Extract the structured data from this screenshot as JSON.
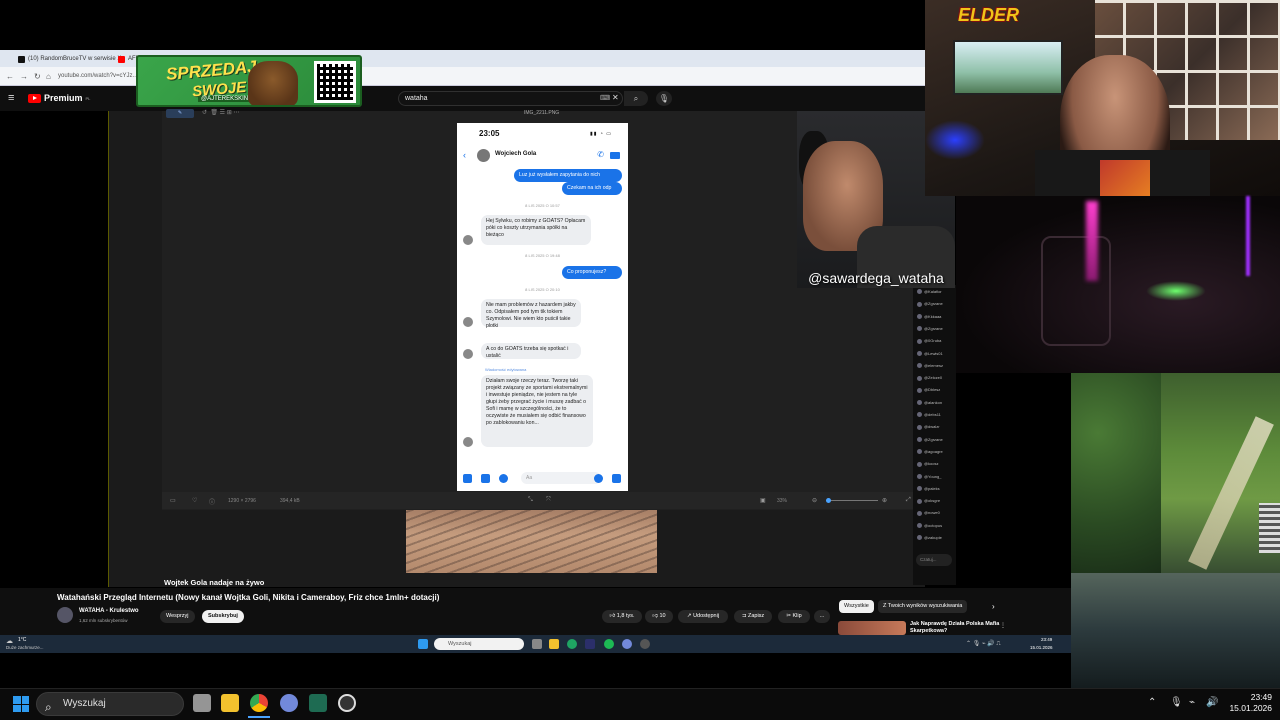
{
  "browser": {
    "tabs": [
      {
        "label": "(10) RandomBruceTV w serwisie X",
        "color": "#111"
      },
      {
        "label": "AFERA ...",
        "color": "#ff0000"
      }
    ],
    "url": "youtube.com/watch?v=cYJz..."
  },
  "promo": {
    "line1": "SPRZEDAJ",
    "line2": "SWOJE SKINY",
    "handle": "@AJTEREKSKINS"
  },
  "youtube": {
    "logo": "Premium",
    "logo_suffix": "PL",
    "search_value": "wataha",
    "stream_label": "Wojtek Gola nadaje na żywo",
    "video_title": "Watahański Przegląd Internetu (Nowy kanał Wojtka Goli, Nikita i Cameraboy, Friz chce 1mln+ dotacji)",
    "channel": {
      "name": "WATAHA - Krulestwo",
      "subs": "1,62 mln subskrybentów"
    },
    "support_btn": "Wesprzyj",
    "subscribe_btn": "Subskrybuj",
    "actions": {
      "likes": "1,8 tys.",
      "dislikes": "10",
      "share": "Udostępnij",
      "save": "Zapisz",
      "clip": "Klip",
      "more": "…"
    },
    "chips": [
      "Wszystkie",
      "Z Twoich wyników wyszukiwania"
    ],
    "next_video_title": "Jak Naprawdę Działa Polska Mafia Skarpetkowa?",
    "chat_placeholder": "Czatuj..."
  },
  "viewer": {
    "filename": "IMG_2211.PNG",
    "dimensions": "1290 × 2796",
    "filesize": "394,4 kB",
    "zoom": "33%"
  },
  "phone": {
    "time": "23:05",
    "contact": "Wojciech Gola",
    "composer_placeholder": "Aa",
    "messages": [
      {
        "dir": "out",
        "text": "Luz już wysłałem zapytania do nich"
      },
      {
        "dir": "out",
        "text": "Czekam na ich odp"
      },
      {
        "dir": "ts",
        "text": "8 LIS 2025 O 10:57"
      },
      {
        "dir": "in",
        "text": "Hej Sylwku, co robimy z GOATS? Opłacam póki co koszty utrzymania spółki na bieżąco"
      },
      {
        "dir": "ts",
        "text": "8 LIS 2025 O 19:48"
      },
      {
        "dir": "out",
        "text": "Co proponujesz?"
      },
      {
        "dir": "ts",
        "text": "8 LIS 2025 O 20:10"
      },
      {
        "dir": "in",
        "text": "Nie mam problemów z hazardem jakby co. Odpisałem pod tym tik tokiem Szymolowi. Nie wiem kto puścił takie plotki"
      },
      {
        "dir": "in",
        "text": "A co do GOATS trzeba się spotkać i ustalić"
      },
      {
        "dir": "edited",
        "text": "Wiadomość edytowana"
      },
      {
        "dir": "in",
        "text": "Działam swoje rzeczy teraz. Tworzę taki projekt związany ze sportami ekstremalnymi i inwestuje pieniądze, nie jestem na tyle głupi żeby przegrać życie i muszę zadbać o Sofi i mamę w szczególności, że to oczywiste że musiałem się odbić finansowo po zablokowaniu kon..."
      }
    ]
  },
  "chat_users": [
    "@Kalafior",
    "@Zgrzane",
    "@Kkkaaa",
    "@Zgrzane",
    "@0Gruba",
    "@Lewis01",
    "@elemesz",
    "@Zelcze0",
    "@Dblesz",
    "@alankon",
    "@debs11",
    "@dwalzr",
    "@Zgrzane",
    "@agoagre",
    "@koosz",
    "@Young_",
    "@paleks",
    "@oksgre",
    "@nowe0",
    "@octopus",
    "@zakupie"
  ],
  "webcam": {
    "tag": "@sawardega_wataha"
  },
  "overlay_logo": "ELDER",
  "inner_taskbar": {
    "weather_temp": "1°C",
    "weather_desc": "Duże zachmurze...",
    "search": "Wyszukaj",
    "time": "23:49",
    "date": "15.01.2026"
  },
  "taskbar": {
    "search": "Wyszukaj",
    "time": "23:49",
    "date": "15.01.2026"
  },
  "colors": {
    "accent": "#1a73e8",
    "youtube_red": "#ff0000",
    "taskbar": "#0b0b0b"
  }
}
